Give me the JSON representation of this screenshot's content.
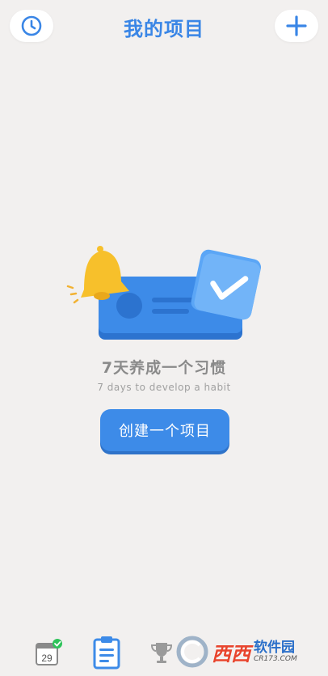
{
  "header": {
    "title": "我的项目",
    "left_icon": "clock-icon",
    "right_icon": "plus-icon"
  },
  "empty_state": {
    "slogan": "7天养成一个习惯",
    "slogan_en": "7 days to develop a habit",
    "illustration_icons": [
      "bell-icon",
      "card-icon",
      "check-icon"
    ]
  },
  "create_button": {
    "label": "创建一个项目"
  },
  "tabbar": {
    "items": [
      {
        "icon": "calendar-check-icon",
        "label": "29"
      },
      {
        "icon": "clipboard-icon",
        "active": true
      },
      {
        "icon": "trophy-icon"
      }
    ]
  },
  "watermark": {
    "brand": "西西",
    "sub": "软件园",
    "url": "CR173.COM"
  },
  "colors": {
    "accent": "#3d8be8",
    "title": "#3a86e6",
    "background": "#f2f0ef",
    "bell": "#f7c02b",
    "check_badge": "#2ec35a"
  }
}
